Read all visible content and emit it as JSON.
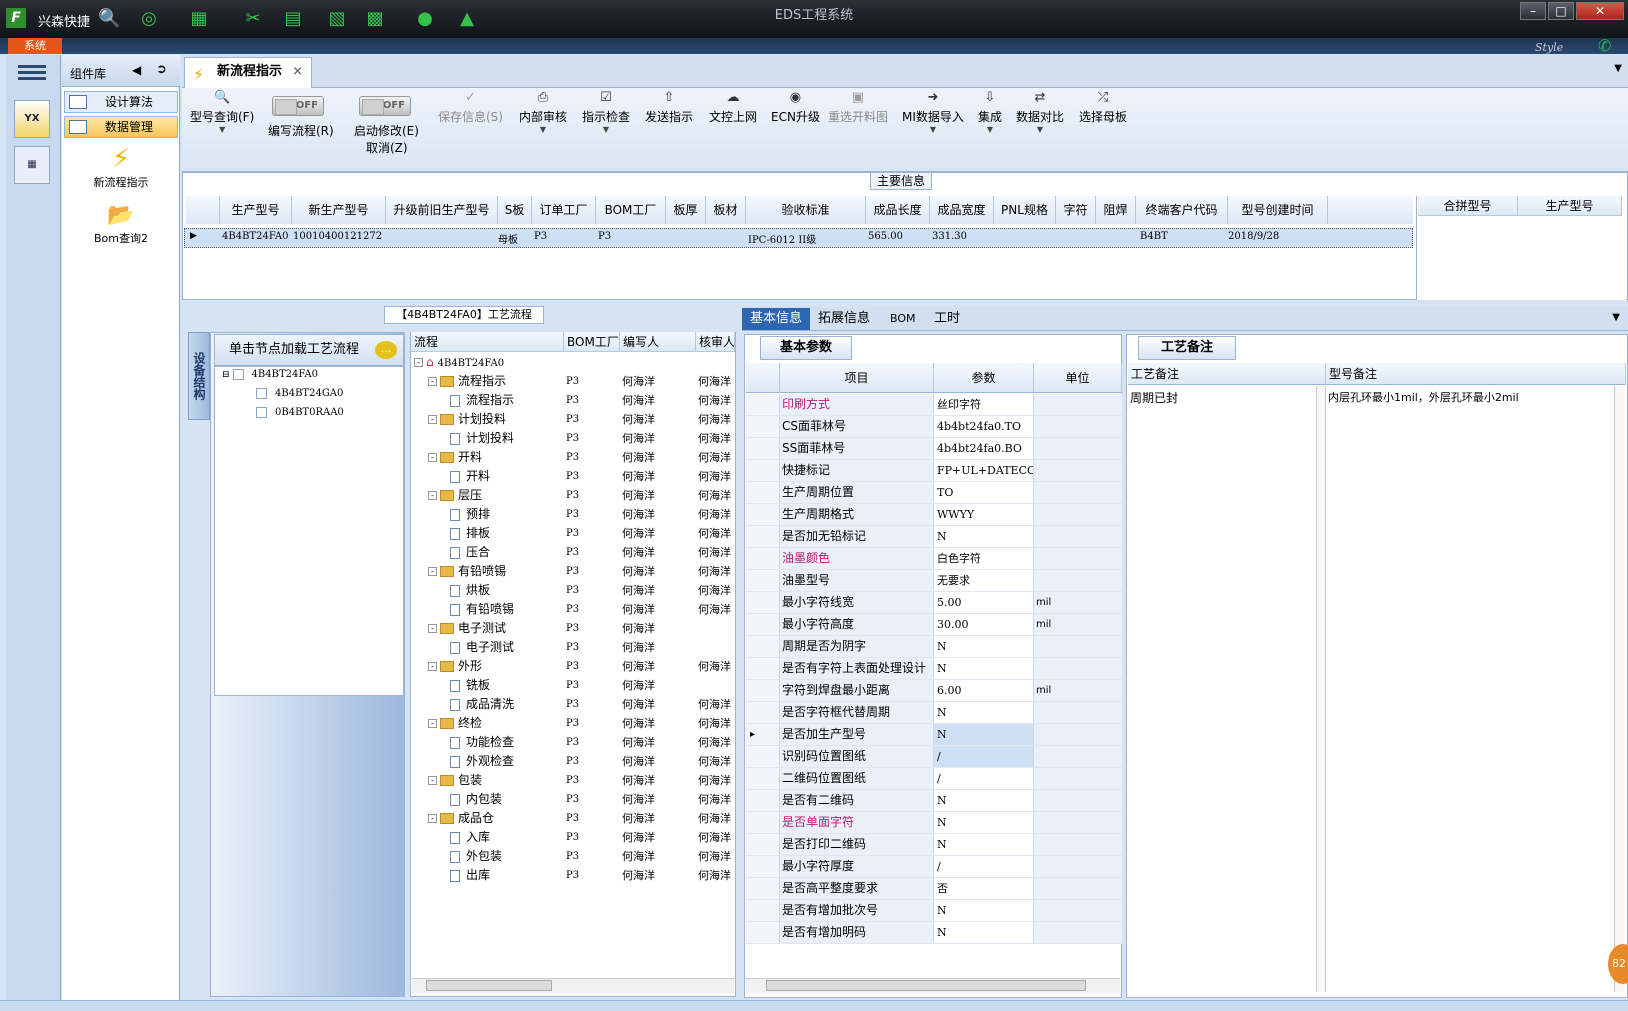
{
  "app": {
    "title": "EDS工程系统",
    "quick_label": "兴森快捷",
    "system_button": "系统",
    "style_label": "Style"
  },
  "sidebar": {
    "panel_title": "组件库",
    "items": [
      {
        "label": "设计算法"
      },
      {
        "label": "数据管理"
      }
    ],
    "shortcuts": [
      {
        "label": "新流程指示",
        "icon": "lightning-icon"
      },
      {
        "label": "Bom查询2",
        "icon": "folder-icon"
      }
    ]
  },
  "tab": {
    "label": "新流程指示"
  },
  "toolbar": {
    "model_query": "型号查询(F)",
    "edit_flow": "编写流程(R)",
    "edit_flow_toggle": "OFF",
    "enable_edit": "启动修改(E)",
    "enable_edit_toggle": "OFF",
    "cancel": "取消(Z)",
    "save_info": "保存信息(S)",
    "internal_review": "内部审核",
    "instruction_check": "指示检查",
    "send_instruction": "发送指示",
    "upload": "文控上网",
    "ecn": "ECN升级",
    "reselect_image": "重选开料图",
    "mi_import": "MI数据导入",
    "integrate": "集成",
    "data_compare": "数据对比",
    "select_mother": "选择母板"
  },
  "main_info": {
    "label": "主要信息",
    "columns": [
      "生产型号",
      "新生产型号",
      "升级前旧生产型号",
      "S板",
      "订单工厂",
      "BOM工厂",
      "板厚",
      "板材",
      "验收标准",
      "成品长度",
      "成品宽度",
      "PNL规格",
      "字符",
      "阻焊",
      "终端客户代码",
      "型号创建时间"
    ],
    "row": {
      "prod_model": "4B4BT24FA0",
      "new_model": "10010400121272",
      "old_model": "",
      "s_board": "母板",
      "order_factory": "P3",
      "bom_factory": "P3",
      "thickness": "",
      "material": "",
      "standard": "IPC-6012 II级",
      "length": "565.00",
      "width": "331.30",
      "pnl": "",
      "char": "",
      "mask": "",
      "customer": "B4BT",
      "created": "2018/9/28"
    },
    "side_columns": [
      "合拼型号",
      "生产型号"
    ]
  },
  "process": {
    "title": "【4B4BT24FA0】工艺流程",
    "vertical_tab": "设备结构",
    "tree_header": "单击节点加载工艺流程",
    "tree": [
      {
        "label": "4B4BT24FA0",
        "level": 0
      },
      {
        "label": "4B4BT24GA0",
        "level": 1
      },
      {
        "label": "0B4BT0RAA0",
        "level": 1
      }
    ],
    "columns": [
      "流程",
      "BOM工厂",
      "编写人",
      "核审人"
    ],
    "root": "4B4BT24FA0",
    "rows": [
      {
        "name": "流程指示",
        "folder": true,
        "factory": "P3",
        "writer": "何海洋",
        "reviewer": "何海洋"
      },
      {
        "name": "流程指示",
        "folder": false,
        "factory": "P3",
        "writer": "何海洋",
        "reviewer": "何海洋"
      },
      {
        "name": "计划投料",
        "folder": true,
        "factory": "P3",
        "writer": "何海洋",
        "reviewer": "何海洋"
      },
      {
        "name": "计划投料",
        "folder": false,
        "factory": "P3",
        "writer": "何海洋",
        "reviewer": "何海洋"
      },
      {
        "name": "开料",
        "folder": true,
        "factory": "P3",
        "writer": "何海洋",
        "reviewer": "何海洋"
      },
      {
        "name": "开料",
        "folder": false,
        "factory": "P3",
        "writer": "何海洋",
        "reviewer": "何海洋"
      },
      {
        "name": "层压",
        "folder": true,
        "factory": "P3",
        "writer": "何海洋",
        "reviewer": "何海洋"
      },
      {
        "name": "预排",
        "folder": false,
        "factory": "P3",
        "writer": "何海洋",
        "reviewer": "何海洋"
      },
      {
        "name": "排板",
        "folder": false,
        "factory": "P3",
        "writer": "何海洋",
        "reviewer": "何海洋"
      },
      {
        "name": "压合",
        "folder": false,
        "factory": "P3",
        "writer": "何海洋",
        "reviewer": "何海洋"
      },
      {
        "name": "有铅喷锡",
        "folder": true,
        "factory": "P3",
        "writer": "何海洋",
        "reviewer": "何海洋"
      },
      {
        "name": "烘板",
        "folder": false,
        "factory": "P3",
        "writer": "何海洋",
        "reviewer": "何海洋"
      },
      {
        "name": "有铅喷锡",
        "folder": false,
        "factory": "P3",
        "writer": "何海洋",
        "reviewer": "何海洋"
      },
      {
        "name": "电子测试",
        "folder": true,
        "factory": "P3",
        "writer": "何海洋",
        "reviewer": ""
      },
      {
        "name": "电子测试",
        "folder": false,
        "factory": "P3",
        "writer": "何海洋",
        "reviewer": ""
      },
      {
        "name": "外形",
        "folder": true,
        "factory": "P3",
        "writer": "何海洋",
        "reviewer": "何海洋"
      },
      {
        "name": "铣板",
        "folder": false,
        "factory": "P3",
        "writer": "何海洋",
        "reviewer": ""
      },
      {
        "name": "成品清洗",
        "folder": false,
        "factory": "P3",
        "writer": "何海洋",
        "reviewer": "何海洋"
      },
      {
        "name": "终检",
        "folder": true,
        "factory": "P3",
        "writer": "何海洋",
        "reviewer": "何海洋"
      },
      {
        "name": "功能检查",
        "folder": false,
        "factory": "P3",
        "writer": "何海洋",
        "reviewer": "何海洋"
      },
      {
        "name": "外观检查",
        "folder": false,
        "factory": "P3",
        "writer": "何海洋",
        "reviewer": "何海洋"
      },
      {
        "name": "包装",
        "folder": true,
        "factory": "P3",
        "writer": "何海洋",
        "reviewer": "何海洋"
      },
      {
        "name": "内包装",
        "folder": false,
        "factory": "P3",
        "writer": "何海洋",
        "reviewer": "何海洋"
      },
      {
        "name": "成品仓",
        "folder": true,
        "factory": "P3",
        "writer": "何海洋",
        "reviewer": "何海洋"
      },
      {
        "name": "入库",
        "folder": false,
        "factory": "P3",
        "writer": "何海洋",
        "reviewer": "何海洋"
      },
      {
        "name": "外包装",
        "folder": false,
        "factory": "P3",
        "writer": "何海洋",
        "reviewer": "何海洋"
      },
      {
        "name": "出库",
        "folder": false,
        "factory": "P3",
        "writer": "何海洋",
        "reviewer": "何海洋"
      }
    ]
  },
  "detail_tabs": [
    "基本信息",
    "拓展信息",
    "BOM",
    "工时"
  ],
  "params": {
    "section": "基本参数",
    "columns": [
      "项目",
      "参数",
      "单位"
    ],
    "rows": [
      {
        "k": "印刷方式",
        "v": "丝印字符",
        "u": "",
        "pink": true
      },
      {
        "k": "CS面菲林号",
        "v": "4b4bt24fa0.TO",
        "u": ""
      },
      {
        "k": "SS面菲林号",
        "v": "4b4bt24fa0.BO",
        "u": ""
      },
      {
        "k": "快捷标记",
        "v": "FP+UL+DATECODE",
        "u": ""
      },
      {
        "k": "生产周期位置",
        "v": "TO",
        "u": ""
      },
      {
        "k": "生产周期格式",
        "v": "WWYY",
        "u": ""
      },
      {
        "k": "是否加无铅标记",
        "v": "N",
        "u": ""
      },
      {
        "k": "油墨颜色",
        "v": "白色字符",
        "u": "",
        "pink": true
      },
      {
        "k": "油墨型号",
        "v": "无要求",
        "u": ""
      },
      {
        "k": "最小字符线宽",
        "v": "5.00",
        "u": "mil"
      },
      {
        "k": "最小字符高度",
        "v": "30.00",
        "u": "mil"
      },
      {
        "k": "周期是否为阴字",
        "v": "N",
        "u": ""
      },
      {
        "k": "是否有字符上表面处理设计",
        "v": "N",
        "u": ""
      },
      {
        "k": "字符到焊盘最小距离",
        "v": "6.00",
        "u": "mil"
      },
      {
        "k": "是否字符框代替周期",
        "v": "N",
        "u": ""
      },
      {
        "k": "是否加生产型号",
        "v": "N",
        "u": "",
        "hl": true,
        "current": true
      },
      {
        "k": "识别码位置图纸",
        "v": "/",
        "u": "",
        "hl": true
      },
      {
        "k": "二维码位置图纸",
        "v": "/",
        "u": ""
      },
      {
        "k": "是否有二维码",
        "v": "N",
        "u": ""
      },
      {
        "k": "是否单面字符",
        "v": "N",
        "u": "",
        "pink": true
      },
      {
        "k": "是否打印二维码",
        "v": "N",
        "u": ""
      },
      {
        "k": "最小字符厚度",
        "v": "/",
        "u": ""
      },
      {
        "k": "是否高平整度要求",
        "v": "否",
        "u": ""
      },
      {
        "k": "是否有增加批次号",
        "v": "N",
        "u": ""
      },
      {
        "k": "是否有增加明码",
        "v": "N",
        "u": ""
      }
    ]
  },
  "notes": {
    "tab": "工艺备注",
    "col1": "工艺备注",
    "col2": "型号备注",
    "process_note": "周期已封",
    "model_note": "内层孔环最小1mil，外层孔环最小2mil"
  },
  "badge": "82"
}
